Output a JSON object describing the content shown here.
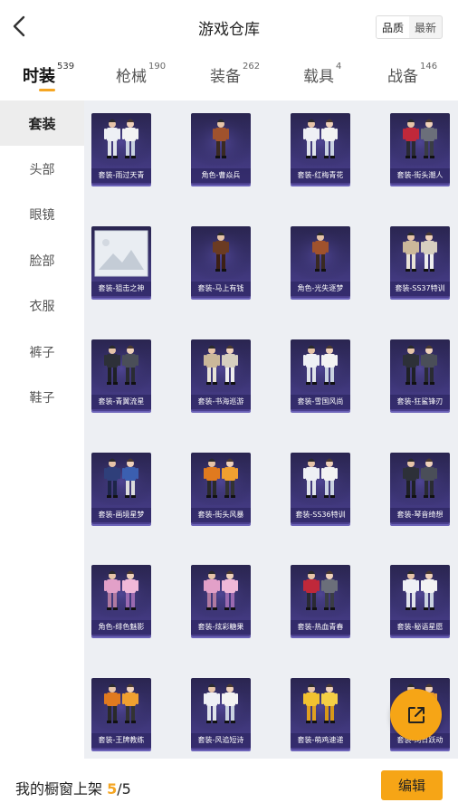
{
  "header": {
    "title": "游戏仓库",
    "sort_options": [
      "品质",
      "最新"
    ]
  },
  "tabs": [
    {
      "label": "时装",
      "count": "539",
      "active": true
    },
    {
      "label": "枪械",
      "count": "190"
    },
    {
      "label": "装备",
      "count": "262"
    },
    {
      "label": "载具",
      "count": "4"
    },
    {
      "label": "战备",
      "count": "146"
    }
  ],
  "sidebar": {
    "items": [
      {
        "label": "套装",
        "active": true
      },
      {
        "label": "头部"
      },
      {
        "label": "眼镜"
      },
      {
        "label": "脸部"
      },
      {
        "label": "衣服"
      },
      {
        "label": "裤子"
      },
      {
        "label": "鞋子"
      }
    ]
  },
  "grid": {
    "items": [
      {
        "label": "套装-雨过天青",
        "palette": "white-outfit"
      },
      {
        "label": "角色-曹焱兵",
        "palette": "warrior"
      },
      {
        "label": "套装-红梅青花",
        "palette": "white-outfit"
      },
      {
        "label": "套装-街头潮人",
        "palette": "red-jacket"
      },
      {
        "label": "套装-狙击之神",
        "palette": "placeholder-image"
      },
      {
        "label": "套装-马上有钱",
        "palette": "brown-suit"
      },
      {
        "label": "角色-光失逐梦",
        "palette": "warrior"
      },
      {
        "label": "套装-SS37特训",
        "palette": "beige-outfit"
      },
      {
        "label": "套装-青翼流星",
        "palette": "dark-armor"
      },
      {
        "label": "套装-书海巡游",
        "palette": "beige-outfit"
      },
      {
        "label": "套装-雪国风尚",
        "palette": "white-outfit"
      },
      {
        "label": "套装-狂鲨锋刃",
        "palette": "dark-armor"
      },
      {
        "label": "套装-画境星梦",
        "palette": "blue-dress"
      },
      {
        "label": "套装-街头风暴",
        "palette": "orange-outfit"
      },
      {
        "label": "套装-SS36特训",
        "palette": "white-outfit"
      },
      {
        "label": "套装-琴音绮想",
        "palette": "dark-armor"
      },
      {
        "label": "角色-绯色魅影",
        "palette": "pink-girl"
      },
      {
        "label": "套装-炫彩糖果",
        "palette": "pink-girl"
      },
      {
        "label": "套装-热血青春",
        "palette": "red-jacket"
      },
      {
        "label": "套装-秘语星愿",
        "palette": "white-outfit"
      },
      {
        "label": "套装-王牌教练",
        "palette": "orange-outfit"
      },
      {
        "label": "套装-风追短诗",
        "palette": "white-outfit"
      },
      {
        "label": "套装-萌鸡速递",
        "palette": "yellow-chicken"
      },
      {
        "label": "套装-绚日跃动",
        "palette": "orange-outfit"
      }
    ]
  },
  "footer": {
    "text_prefix": "我的橱窗上架",
    "current": "5",
    "separator": "/",
    "total": "5",
    "edit_label": "编辑"
  },
  "icons": {
    "back": "chevron-left-icon",
    "share": "share-external-icon"
  },
  "colors": {
    "accent": "#f5a623",
    "content_bg": "#edeff3",
    "card_bg": "#3b3474"
  }
}
